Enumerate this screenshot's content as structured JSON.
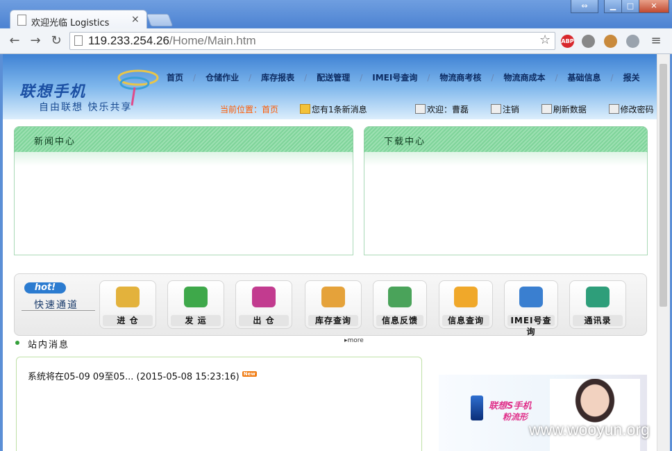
{
  "browser": {
    "tab_title": "欢迎光临 Logistics",
    "tab_close": "×",
    "url_host": "119.233.254.26",
    "url_path": "/Home/Main.htm",
    "back": "←",
    "forward": "→",
    "reload": "↻",
    "star": "☆",
    "menu": "≡",
    "window_restore": "⇔",
    "window_minimize": "▁",
    "window_maximize": "□",
    "window_close": "✕",
    "extensions": [
      {
        "name": "abp-icon",
        "label": "ABP",
        "color": "#d8282d"
      },
      {
        "name": "extension-gray-icon",
        "label": "",
        "color": "#888888"
      },
      {
        "name": "cookie-icon",
        "label": "",
        "color": "#c98a3c"
      },
      {
        "name": "globe-icon",
        "label": "",
        "color": "#9aa3ad"
      }
    ]
  },
  "header": {
    "logo": "联想手机",
    "slogan": "自由联想  快乐共享",
    "nav": [
      "首页",
      "仓储作业",
      "库存报表",
      "配送管理",
      "IMEI号查询",
      "物流商考核",
      "物流商成本",
      "基础信息",
      "报关"
    ],
    "location_label": "当前位置：首页",
    "message": "您有1条新消息",
    "user_links": [
      "欢迎：曹磊",
      "注销",
      "刷新数据",
      "修改密码"
    ]
  },
  "panels": [
    {
      "title": "新闻中心"
    },
    {
      "title": "下载中心"
    }
  ],
  "quick": {
    "badge": "hot!",
    "title": "快速通道",
    "buttons": [
      {
        "label": "进 仓",
        "color": "#e3b23c"
      },
      {
        "label": "发 运",
        "color": "#3ea84a"
      },
      {
        "label": "出 仓",
        "color": "#c23b8f"
      },
      {
        "label": "库存查询",
        "color": "#e5a23a"
      },
      {
        "label": "信息反馈",
        "color": "#4aa35a"
      },
      {
        "label": "信息查询",
        "color": "#f0a82a"
      },
      {
        "label": "IMEI号查询",
        "color": "#3a7fd0"
      },
      {
        "label": "通讯录",
        "color": "#2e9e7a"
      }
    ]
  },
  "site_messages": {
    "title": "站内消息",
    "more": "more",
    "items": [
      {
        "text": "系统将在05-09 09至05... (2015-05-08 15:23:16)",
        "badge": "New"
      }
    ]
  },
  "banner": {
    "headline": "联想S手机",
    "sub": "粉流形"
  },
  "watermark": "www.wooyun.org"
}
